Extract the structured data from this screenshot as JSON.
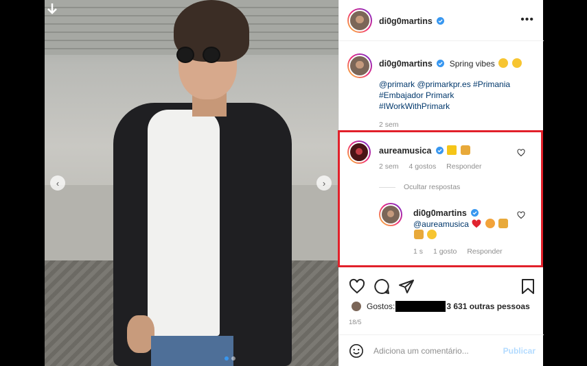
{
  "header": {
    "username": "di0g0martins",
    "more_label": "•••"
  },
  "caption": {
    "username": "di0g0martins",
    "text": "Spring vibes",
    "tags_line1": "@primark @primarkpr.es #Primania",
    "tags_line2": "#Embajador Primark",
    "tags_line3": "#IWorkWithPrimark",
    "time": "2 sem"
  },
  "comment": {
    "username": "aureamusica",
    "time": "2 sem",
    "likes": "4 gostos",
    "reply": "Responder",
    "hide_replies": "Ocultar respostas"
  },
  "reply": {
    "username": "di0g0martins",
    "mention": "@aureamusica",
    "time": "1 s",
    "likes": "1 gosto",
    "reply": "Responder"
  },
  "likes": {
    "prefix": "Gostos:",
    "suffix": "3 631 outras pessoas"
  },
  "date": "18/5",
  "comment_bar": {
    "placeholder": "Adiciona um comentário...",
    "publish": "Publicar"
  },
  "colors": {
    "verified": "#3897f0",
    "highlight_box": "#e1202a",
    "link": "#00376b",
    "publish_disabled": "#b3dbff",
    "heart_red": "#ed4956"
  }
}
